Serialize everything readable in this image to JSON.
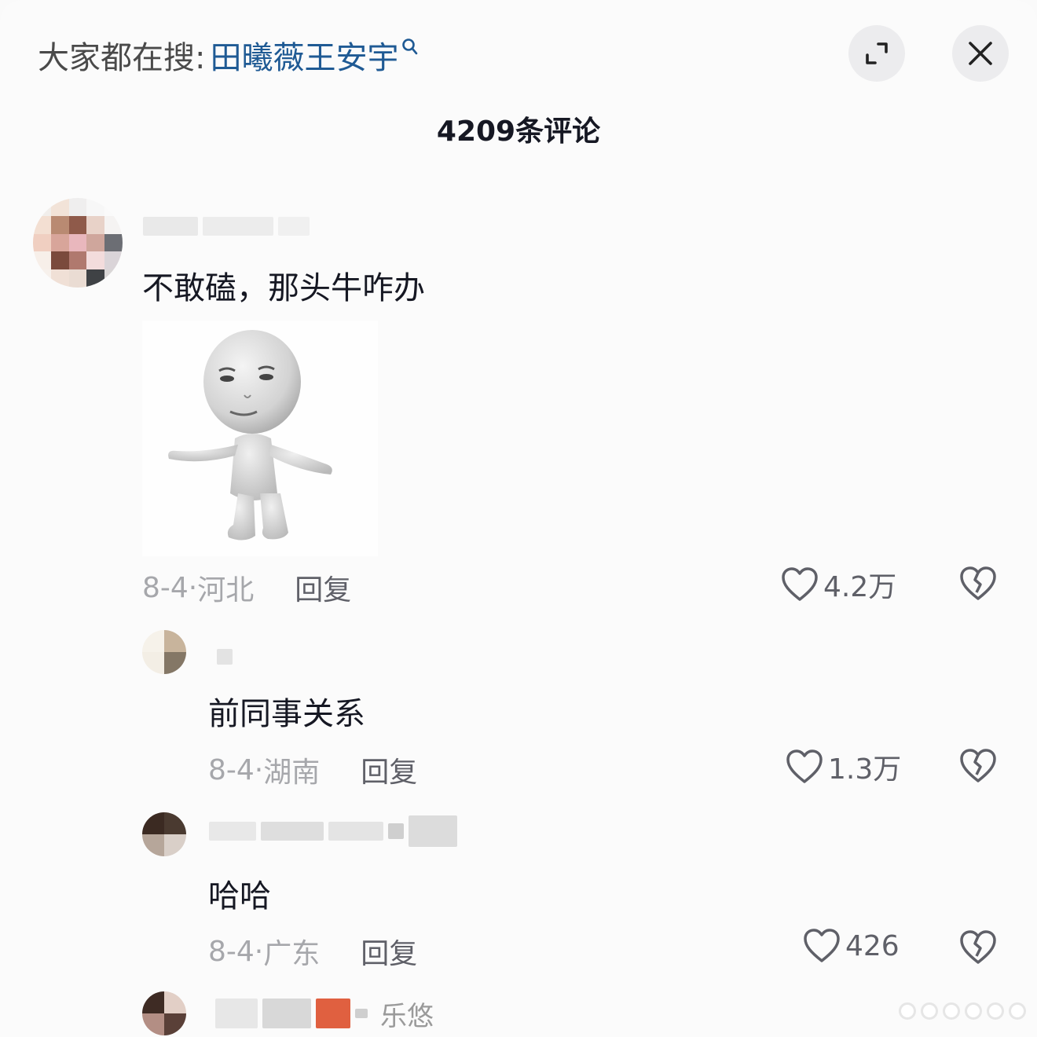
{
  "header": {
    "search_prefix": "大家都在搜:",
    "search_term": "田曦薇王安宇",
    "search_icon": "search-icon",
    "expand_icon": "expand-icon",
    "close_icon": "close-icon"
  },
  "comment_count_title": "4209条评论",
  "comments": [
    {
      "username": "",
      "text": "不敢磕，那头牛咋办",
      "has_sticker": true,
      "date": "8-4·",
      "location": "河北",
      "reply_label": "回复",
      "likes": "4.2万"
    }
  ],
  "replies": [
    {
      "username": "",
      "text": "前同事关系",
      "date": "8-4·",
      "location": "湖南",
      "reply_label": "回复",
      "likes": "1.3万"
    },
    {
      "username": "",
      "text": "哈哈",
      "date": "8-4·",
      "location": "广东",
      "reply_label": "回复",
      "likes": "426"
    },
    {
      "username_visible_fragment": "乐悠"
    }
  ],
  "colors": {
    "search_term": "#1f5a94",
    "meta_text": "#a6a7ab",
    "action_text": "#5f6068",
    "primary_text": "#161823",
    "button_bg": "#ececee"
  }
}
